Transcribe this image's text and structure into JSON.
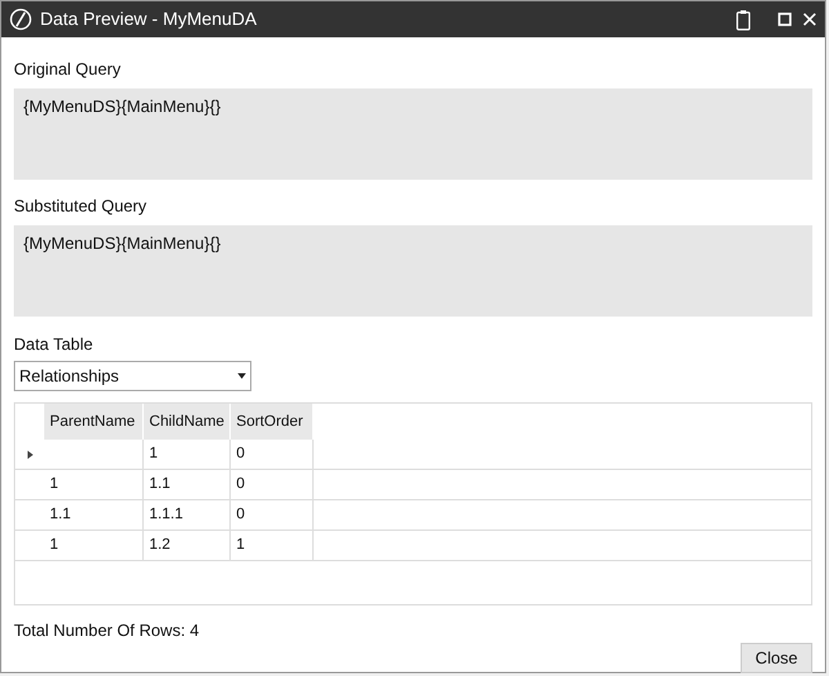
{
  "window": {
    "title": "Data Preview - MyMenuDA"
  },
  "original_query": {
    "label": "Original Query",
    "value": "{MyMenuDS}{MainMenu}{}"
  },
  "substituted_query": {
    "label": "Substituted Query",
    "value": "{MyMenuDS}{MainMenu}{}"
  },
  "data_table": {
    "label": "Data Table",
    "value": "Relationships"
  },
  "table": {
    "columns": [
      "ParentName",
      "ChildName",
      "SortOrder"
    ],
    "rows": [
      {
        "current": true,
        "cells": [
          "",
          "1",
          "0"
        ]
      },
      {
        "current": false,
        "cells": [
          "1",
          "1.1",
          "0"
        ]
      },
      {
        "current": false,
        "cells": [
          "1.1",
          "1.1.1",
          "0"
        ]
      },
      {
        "current": false,
        "cells": [
          "1",
          "1.2",
          "1"
        ]
      }
    ]
  },
  "total_rows": "Total Number Of Rows: 4",
  "buttons": [
    "Close"
  ]
}
